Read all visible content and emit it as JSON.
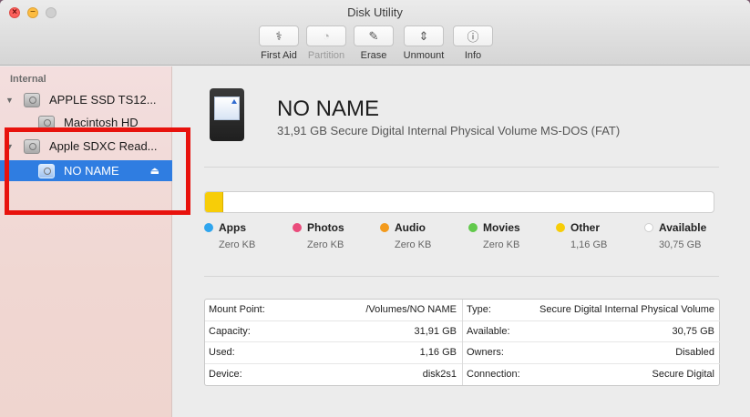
{
  "window": {
    "title": "Disk Utility"
  },
  "toolbar": {
    "buttons": [
      {
        "label": "First Aid",
        "icon": "stethoscope-icon",
        "glyph": "⚕",
        "enabled": true
      },
      {
        "label": "Partition",
        "icon": "pie-chart-icon",
        "glyph": "◔",
        "enabled": false
      },
      {
        "label": "Erase",
        "icon": "eraser-icon",
        "glyph": "✎",
        "enabled": true
      },
      {
        "label": "Unmount",
        "icon": "unmount-icon",
        "glyph": "⇕",
        "enabled": true
      },
      {
        "label": "Info",
        "icon": "info-icon",
        "glyph": "ⓘ",
        "enabled": true
      }
    ]
  },
  "sidebar": {
    "header": "Internal",
    "items": [
      {
        "label": "APPLE SSD TS12...",
        "level": 0,
        "disclosure": "▼",
        "selected": false
      },
      {
        "label": "Macintosh HD",
        "level": 1,
        "disclosure": "",
        "selected": false
      },
      {
        "label": "Apple SDXC Read...",
        "level": 0,
        "disclosure": "▼",
        "selected": false
      },
      {
        "label": "NO NAME",
        "level": 1,
        "disclosure": "",
        "selected": true,
        "eject": "⏏"
      }
    ]
  },
  "volume": {
    "name": "NO NAME",
    "description": "31,91 GB Secure Digital Internal Physical Volume MS-DOS (FAT)"
  },
  "usage": {
    "used_fraction": 0.036,
    "used_color": "#f7cd08",
    "legend": [
      {
        "name": "Apps",
        "value": "Zero KB",
        "color": "#2fa5ee"
      },
      {
        "name": "Photos",
        "value": "Zero KB",
        "color": "#ea4c7c"
      },
      {
        "name": "Audio",
        "value": "Zero KB",
        "color": "#f39a1c"
      },
      {
        "name": "Movies",
        "value": "Zero KB",
        "color": "#62c94c"
      },
      {
        "name": "Other",
        "value": "1,16 GB",
        "color": "#f7cd08"
      },
      {
        "name": "Available",
        "value": "30,75 GB",
        "color": "#ffffff"
      }
    ]
  },
  "info": {
    "left": [
      {
        "key": "Mount Point:",
        "value": "/Volumes/NO NAME"
      },
      {
        "key": "Capacity:",
        "value": "31,91 GB"
      },
      {
        "key": "Used:",
        "value": "1,16 GB"
      },
      {
        "key": "Device:",
        "value": "disk2s1"
      }
    ],
    "right": [
      {
        "key": "Type:",
        "value": "Secure Digital Internal Physical Volume"
      },
      {
        "key": "Available:",
        "value": "30,75 GB"
      },
      {
        "key": "Owners:",
        "value": "Disabled"
      },
      {
        "key": "Connection:",
        "value": "Secure Digital"
      }
    ]
  }
}
